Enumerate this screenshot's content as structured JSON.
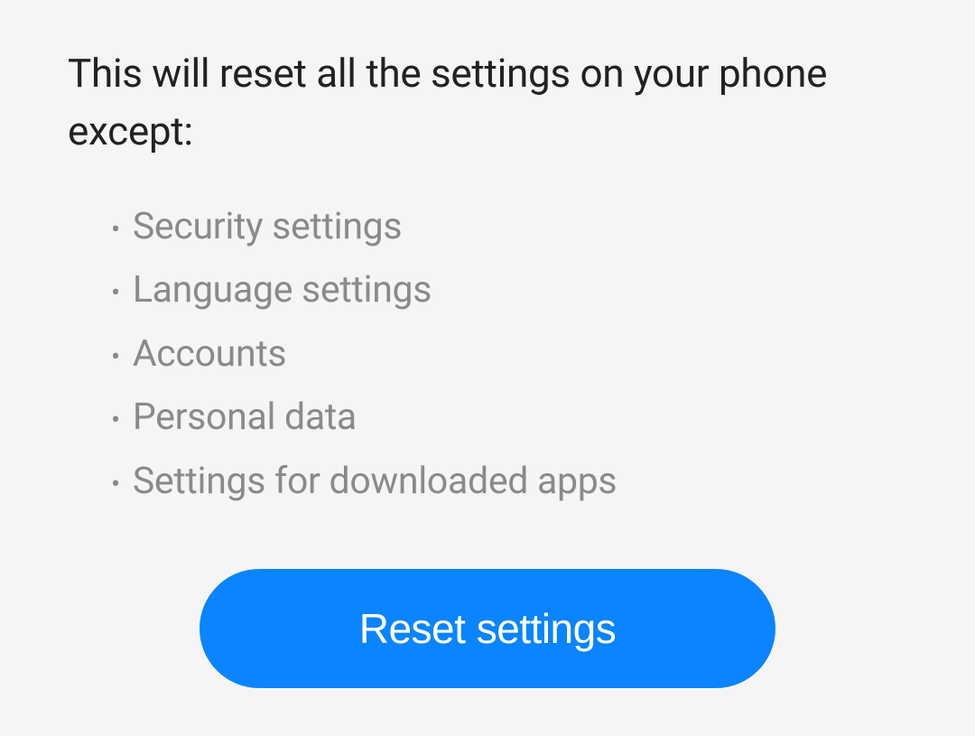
{
  "intro_text": "This will reset all the settings on your phone except:",
  "exceptions": {
    "items": [
      {
        "label": "Security settings"
      },
      {
        "label": "Language settings"
      },
      {
        "label": "Accounts"
      },
      {
        "label": "Personal data"
      },
      {
        "label": "Settings for downloaded apps"
      }
    ]
  },
  "button": {
    "label": "Reset settings"
  },
  "colors": {
    "accent": "#0a84ff",
    "background": "#f5f5f5",
    "text_primary": "#222222",
    "text_secondary": "#8a8a8a"
  }
}
